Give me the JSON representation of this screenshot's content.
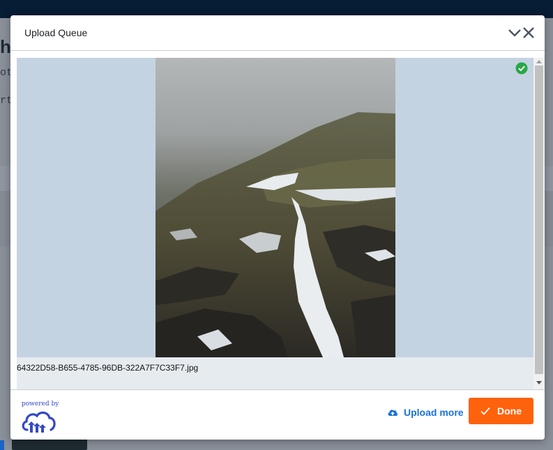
{
  "background": {
    "heading_fragment": "h",
    "line1_fragment": "ot",
    "line2_fragment": "rt"
  },
  "modal": {
    "title": "Upload Queue",
    "header_icons": [
      "chevron-down-icon",
      "close-icon"
    ]
  },
  "queue": {
    "items": [
      {
        "file_name": "64322D58-B655-4785-96DB-322A7F7C33F7.jpg",
        "status": "uploaded",
        "status_icon": "check-circle-icon",
        "status_color": "#28a745"
      }
    ]
  },
  "footer": {
    "powered_by": "powered by",
    "logo_icon": "cloudinary-cloud-logo",
    "upload_more_label": "Upload more",
    "upload_more_icon": "cloud-upload-icon",
    "done_label": "Done",
    "done_icon": "check-icon"
  },
  "colors": {
    "accent_orange": "#ff620c",
    "link_blue": "#1a73d9",
    "brand_blue": "#3448c5",
    "topbar": "#071c35"
  }
}
